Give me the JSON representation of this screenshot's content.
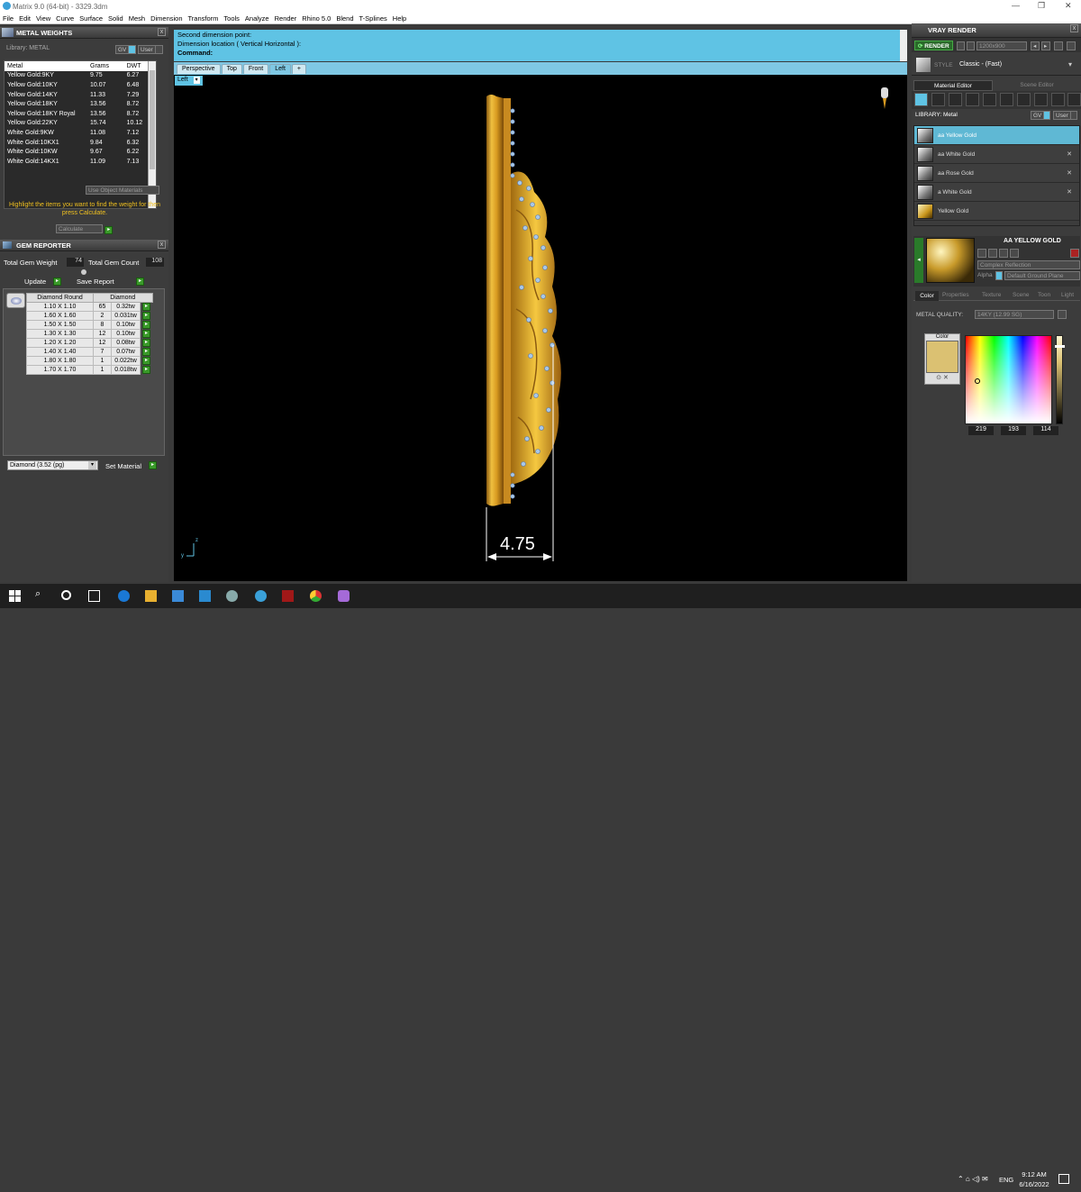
{
  "window": {
    "title": "Matrix 9.0 (64-bit) - 3329.3dm"
  },
  "menu": [
    "File",
    "Edit",
    "View",
    "Curve",
    "Surface",
    "Solid",
    "Mesh",
    "Dimension",
    "Transform",
    "Tools",
    "Analyze",
    "Render",
    "Rhino 5.0",
    "Blend",
    "T-Splines",
    "Help"
  ],
  "metal_weights": {
    "title": "METAL WEIGHTS",
    "library_label": "Library: METAL",
    "gv_label": "GV",
    "user_label": "User",
    "columns": [
      "Metal",
      "Grams",
      "DWT"
    ],
    "rows": [
      {
        "metal": "Yellow Gold:9KY",
        "grams": "9.75",
        "dwt": "6.27"
      },
      {
        "metal": "Yellow Gold:10KY",
        "grams": "10.07",
        "dwt": "6.48"
      },
      {
        "metal": "Yellow Gold:14KY",
        "grams": "11.33",
        "dwt": "7.29"
      },
      {
        "metal": "Yellow Gold:18KY",
        "grams": "13.56",
        "dwt": "8.72"
      },
      {
        "metal": "Yellow Gold:18KY Royal",
        "grams": "13.56",
        "dwt": "8.72"
      },
      {
        "metal": "Yellow Gold:22KY",
        "grams": "15.74",
        "dwt": "10.12"
      },
      {
        "metal": "White Gold:9KW",
        "grams": "11.08",
        "dwt": "7.12"
      },
      {
        "metal": "White Gold:10KX1",
        "grams": "9.84",
        "dwt": "6.32"
      },
      {
        "metal": "White Gold:10KW",
        "grams": "9.67",
        "dwt": "6.22"
      },
      {
        "metal": "White Gold:14KX1",
        "grams": "11.09",
        "dwt": "7.13"
      }
    ],
    "use_object_materials": "Use Object Materials",
    "hint": "Highlight the items you want to find the weight for then press Calculate.",
    "calculate": "Calculate"
  },
  "gem_reporter": {
    "title": "GEM REPORTER",
    "total_weight_label": "Total Gem Weight",
    "total_weight": "74",
    "total_count_label": "Total Gem Count",
    "total_count": "108",
    "update": "Update",
    "save_report": "Save Report",
    "columns": [
      "Diamond Round",
      "Diamond"
    ],
    "rows": [
      {
        "size": "1.10 X 1.10",
        "count": "65",
        "wt": "0.32tw"
      },
      {
        "size": "1.60 X 1.60",
        "count": "2",
        "wt": "0.031tw"
      },
      {
        "size": "1.50 X 1.50",
        "count": "8",
        "wt": "0.10tw"
      },
      {
        "size": "1.30 X 1.30",
        "count": "12",
        "wt": "0.10tw"
      },
      {
        "size": "1.20 X 1.20",
        "count": "12",
        "wt": "0.08tw"
      },
      {
        "size": "1.40 X 1.40",
        "count": "7",
        "wt": "0.07tw"
      },
      {
        "size": "1.80 X 1.80",
        "count": "1",
        "wt": "0.022tw"
      },
      {
        "size": "1.70 X 1.70",
        "count": "1",
        "wt": "0.018tw"
      }
    ],
    "material_select": "Diamond     (3.52 (pg)",
    "set_material": "Set Material"
  },
  "command": {
    "line1": "Second dimension point:",
    "line2": "Dimension location ( Vertical  Horizontal ):",
    "prompt": "Command:"
  },
  "viewport": {
    "tabs": [
      "Perspective",
      "Top",
      "Front",
      "Left"
    ],
    "active_tab": "Left",
    "view_label": "Left",
    "dimension": "4.75",
    "axis_z": "z",
    "axis_y": "y"
  },
  "vray": {
    "title": "VRAY RENDER",
    "render": "RENDER",
    "resolution": "1200x900",
    "style_label": "STYLE",
    "style_value": "Classic - (Fast)",
    "tabs": [
      "Material Editor",
      "Scene Editor"
    ],
    "library_label": "LIBRARY: Metal",
    "gv_label": "GV",
    "user_label": "User",
    "library": [
      {
        "name": "aa Yellow Gold",
        "selected": true
      },
      {
        "name": "aa White Gold",
        "selected": false
      },
      {
        "name": "aa Rose Gold",
        "selected": false
      },
      {
        "name": "a White Gold",
        "selected": false
      },
      {
        "name": "Yellow Gold",
        "selected": false
      }
    ],
    "material_name": "AA YELLOW GOLD",
    "reflection": "Complex Reflection",
    "alpha": "Alpha",
    "ground": "Default Ground Plane",
    "sub_tabs": [
      "Color",
      "Properties",
      "Texture",
      "Scene",
      "Toon",
      "Light"
    ],
    "metal_quality_label": "METAL QUALITY:",
    "metal_quality_value": "14KY       (12.99 SG)",
    "color_label": "Color",
    "rgb": {
      "r": "219",
      "g": "193",
      "b": "114"
    },
    "swatch": "#dbc172"
  },
  "taskbar": {
    "lang": "ENG",
    "time": "9:12 AM",
    "date": "6/16/2022"
  },
  "colors": {
    "accent": "#5fc3e4",
    "gold": "#d9a52a",
    "gem": "#a8c8e8"
  }
}
